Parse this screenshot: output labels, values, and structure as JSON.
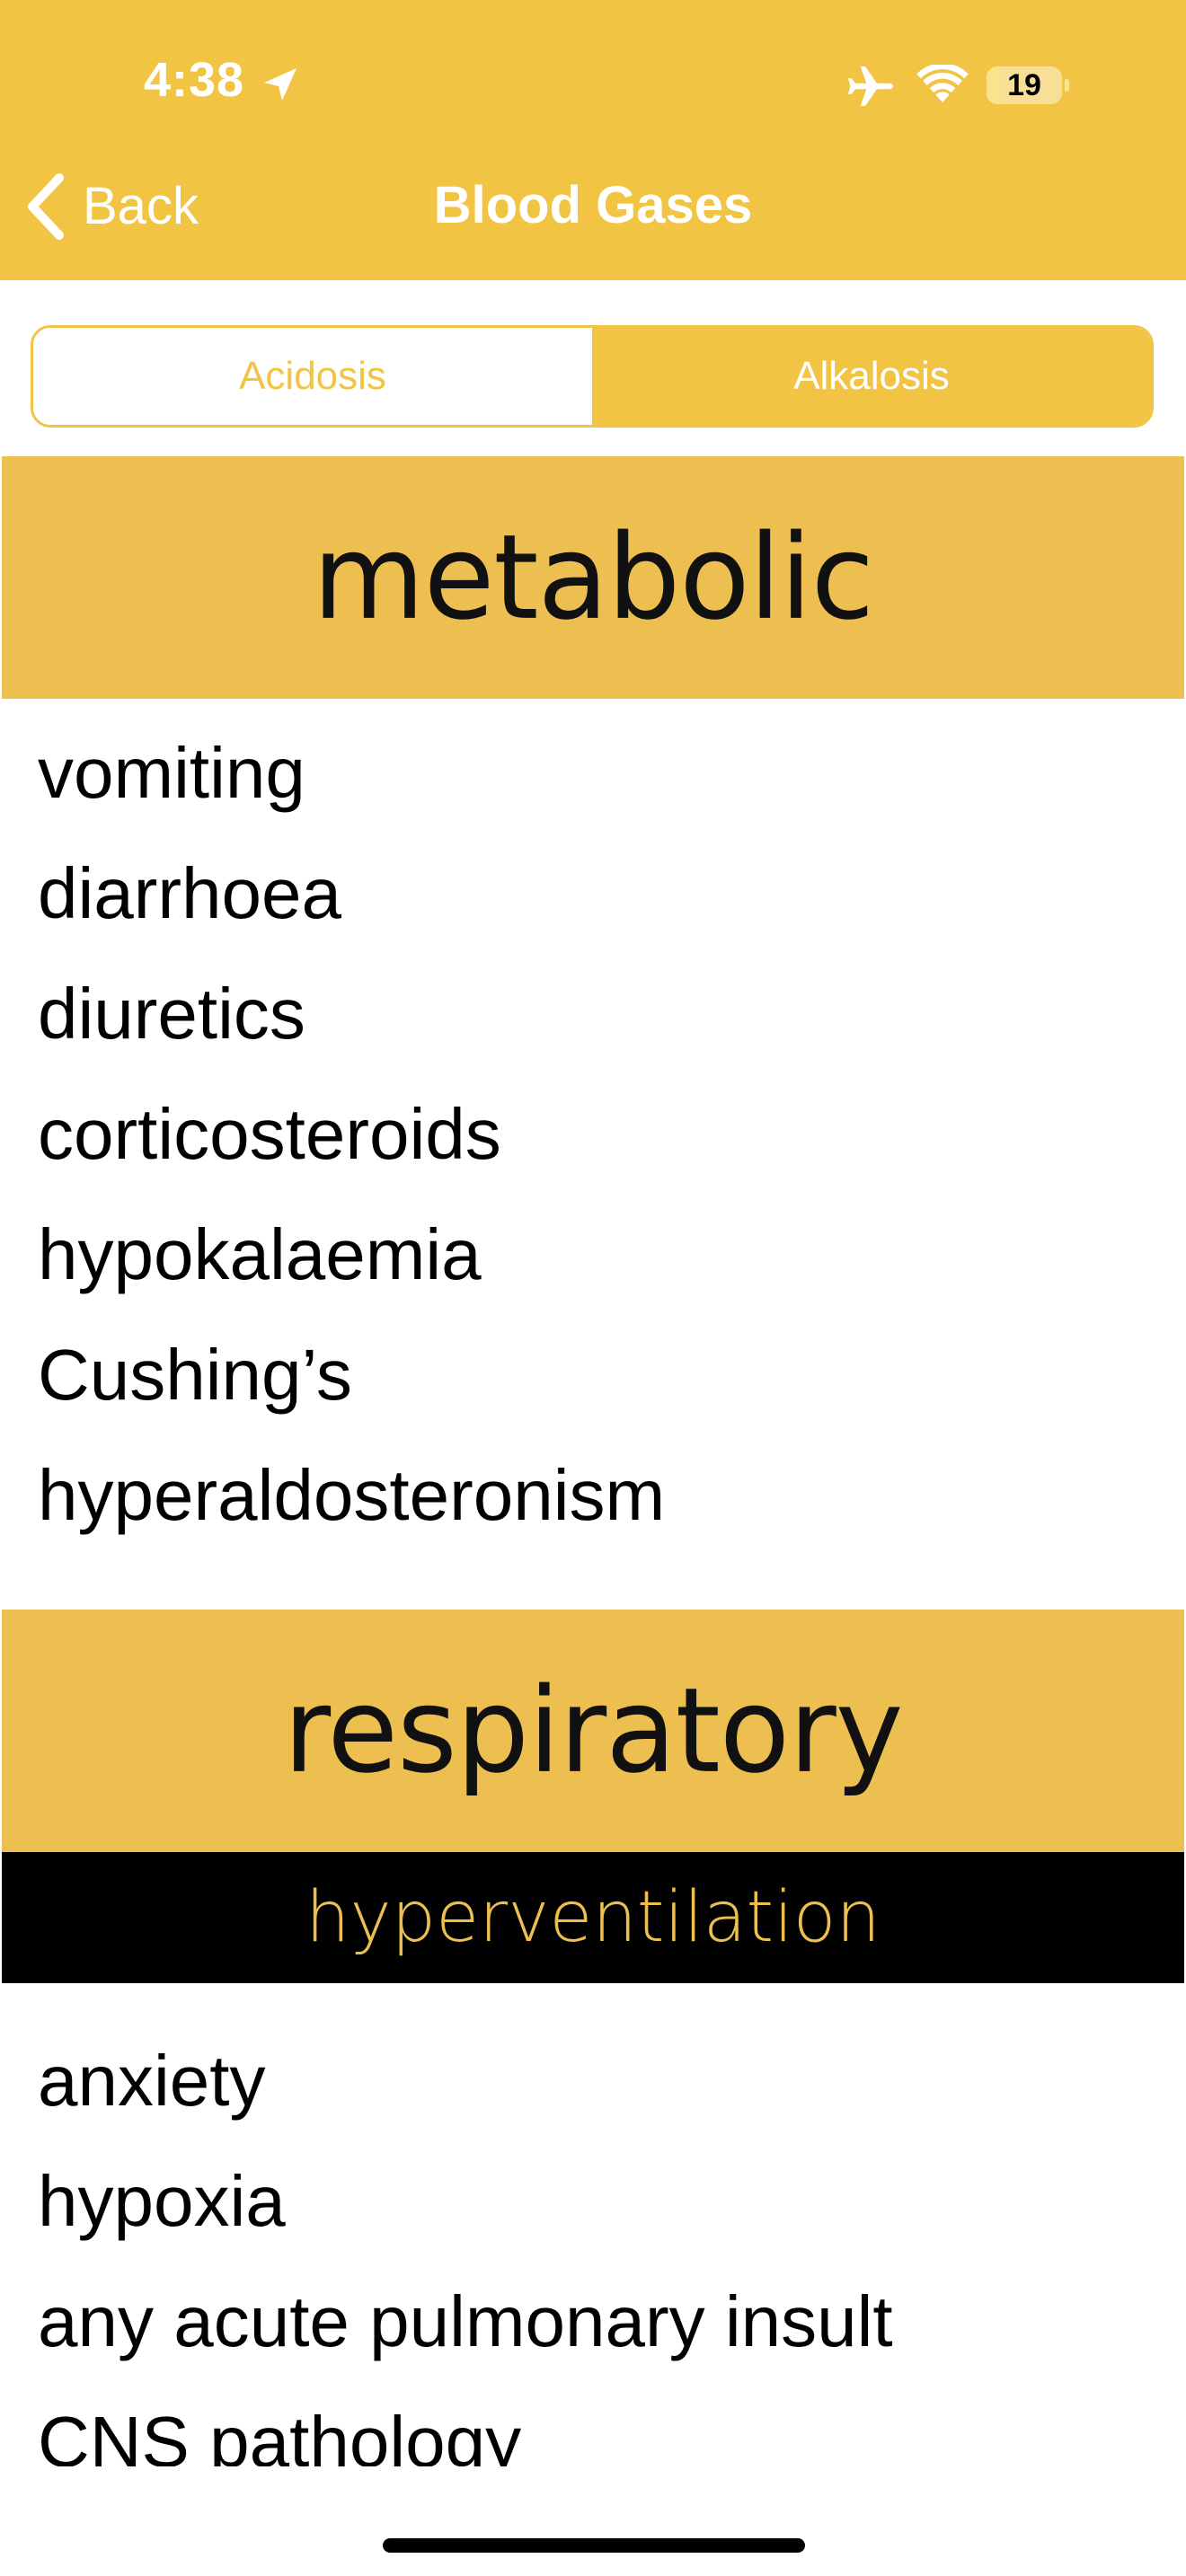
{
  "status_bar": {
    "time": "4:38",
    "battery_level": "19",
    "battery_fraction": 0.19
  },
  "nav": {
    "back_label": "Back",
    "title": "Blood Gases"
  },
  "segments": [
    {
      "label": "Acidosis",
      "selected": false
    },
    {
      "label": "Alkalosis",
      "selected": true
    }
  ],
  "sections": {
    "metabolic": {
      "title": "metabolic",
      "items": [
        "vomiting",
        "diarrhoea",
        "diuretics",
        "corticosteroids",
        "hypokalaemia",
        "Cushing’s",
        "hyperaldosteronism"
      ]
    },
    "respiratory": {
      "title": "respiratory",
      "subtitle": "hyperventilation",
      "items": [
        "anxiety",
        "hypoxia",
        "any acute pulmonary insult",
        "CNS pathology"
      ]
    }
  },
  "colors": {
    "nav_bar": "#f2c443",
    "section_header": "#edbf51",
    "subheader_bg": "#000000",
    "subheader_text": "#edbf51"
  },
  "icons": {
    "status": [
      "location-arrow-icon",
      "airplane-icon",
      "wifi-icon",
      "battery-icon"
    ],
    "nav": "chevron-left-icon"
  }
}
